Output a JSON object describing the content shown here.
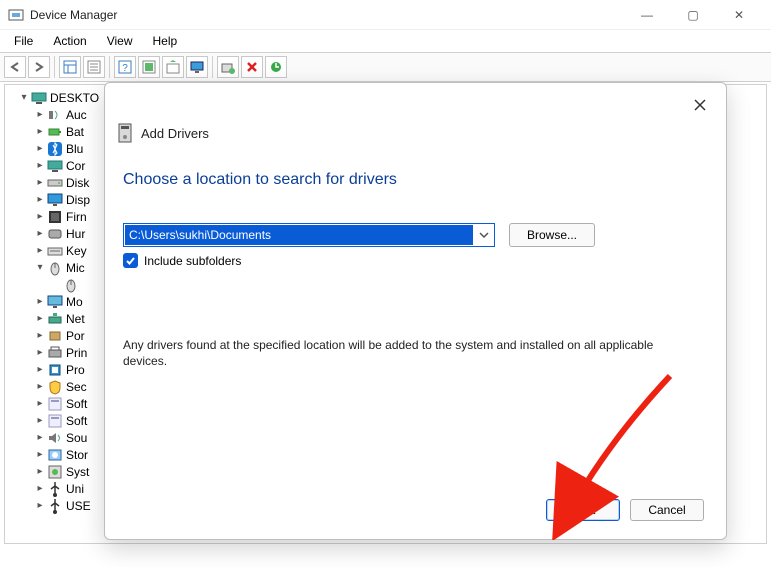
{
  "window": {
    "title": "Device Manager",
    "sys": {
      "min": "—",
      "max": "▢",
      "close": "✕"
    }
  },
  "menu": {
    "file": "File",
    "action": "Action",
    "view": "View",
    "help": "Help"
  },
  "toolbar": {
    "back": "←",
    "fwd": "→",
    "up": "⇧",
    "props": "☰",
    "help": "?",
    "scan": "⟳",
    "grid": "▦",
    "driver": "⚙",
    "monitor": "🖥",
    "disk": "💾",
    "delete": "✖",
    "refresh": "⟳"
  },
  "tree": {
    "root": "DESKTO",
    "items": [
      {
        "label": "Auc",
        "icon": "audio"
      },
      {
        "label": "Bat",
        "icon": "battery"
      },
      {
        "label": "Blu",
        "icon": "bluetooth"
      },
      {
        "label": "Cor",
        "icon": "computer"
      },
      {
        "label": "Disk",
        "icon": "disk"
      },
      {
        "label": "Disp",
        "icon": "display"
      },
      {
        "label": "Firn",
        "icon": "firmware"
      },
      {
        "label": "Hur",
        "icon": "hid"
      },
      {
        "label": "Key",
        "icon": "keyboard"
      },
      {
        "label": "Mic",
        "icon": "mouse",
        "expanded": true,
        "child": ""
      },
      {
        "label": "Mo",
        "icon": "monitor"
      },
      {
        "label": "Net",
        "icon": "network"
      },
      {
        "label": "Por",
        "icon": "port"
      },
      {
        "label": "Prin",
        "icon": "printer"
      },
      {
        "label": "Pro",
        "icon": "processor"
      },
      {
        "label": "Sec",
        "icon": "security"
      },
      {
        "label": "Soft",
        "icon": "software"
      },
      {
        "label": "Soft",
        "icon": "software"
      },
      {
        "label": "Sou",
        "icon": "sound"
      },
      {
        "label": "Stor",
        "icon": "storage"
      },
      {
        "label": "Syst",
        "icon": "system"
      },
      {
        "label": "Uni",
        "icon": "usb"
      },
      {
        "label": "USE",
        "icon": "usb"
      }
    ]
  },
  "dialog": {
    "header_icon": "drive",
    "header": "Add Drivers",
    "title": "Choose a location to search for drivers",
    "path": "C:\\Users\\sukhi\\Documents",
    "browse": "Browse...",
    "include_subfolders_checked": true,
    "include_subfolders": "Include subfolders",
    "note": "Any drivers found at the specified location will be added to the system and installed on all applicable devices.",
    "next": "Next",
    "cancel": "Cancel"
  }
}
